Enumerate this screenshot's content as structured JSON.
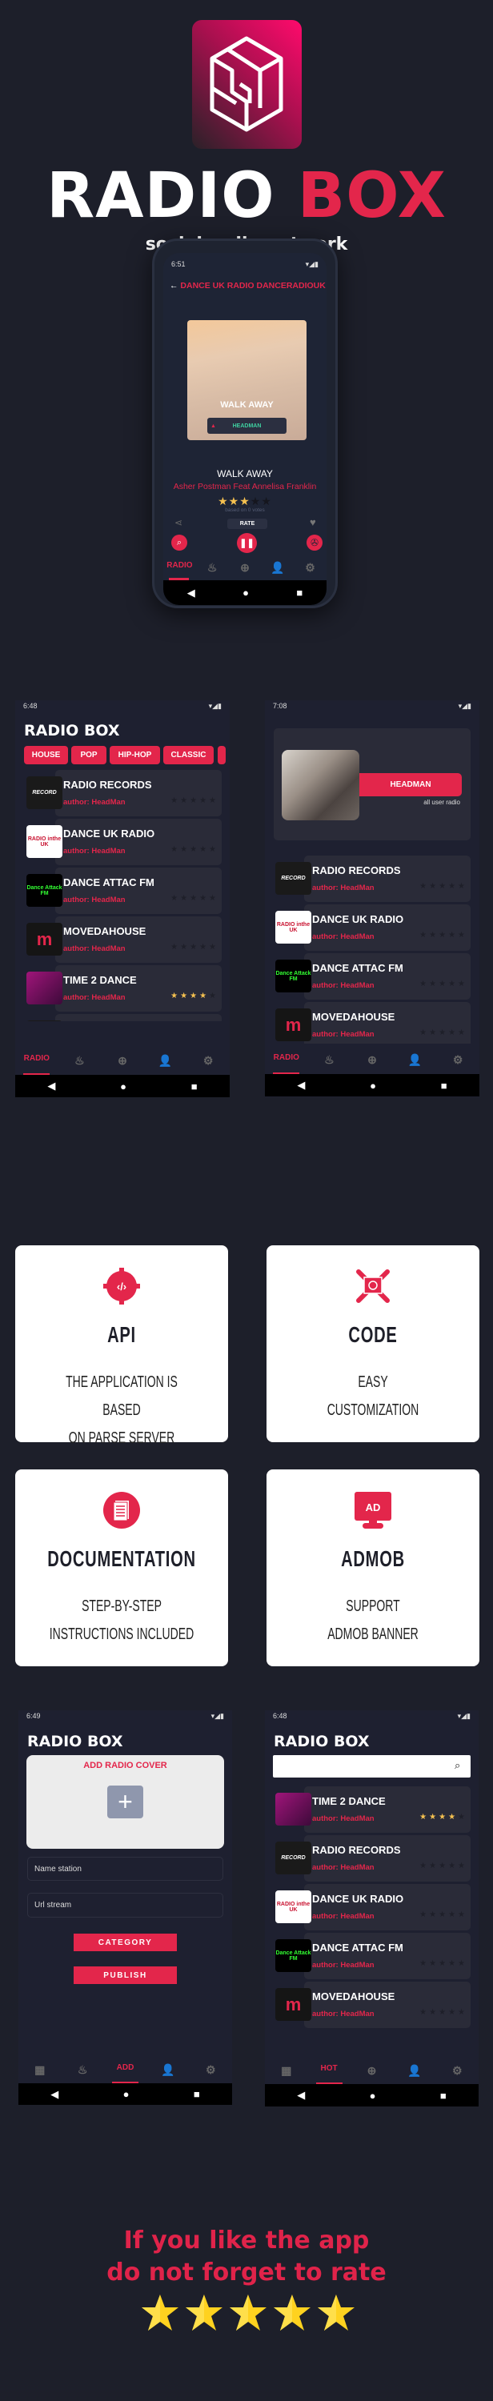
{
  "brand": {
    "title_a": "RADIO",
    "title_b": "BOX",
    "subtitle": "social radio network",
    "accent": "#e3264b"
  },
  "player": {
    "time": "6:51",
    "header": "DANCE UK RADIO DANCERADIOUK",
    "cover_text": "WALK AWAY",
    "cover_artist_chip": "HEADMAN",
    "track": "WALK AWAY",
    "artist": "Asher Postman Feat Annelisa Franklin",
    "rating": 3,
    "votes": "based on 0 votes",
    "rate_label": "RATE",
    "nav_active": "RADIO"
  },
  "nav_icons": [
    "radio",
    "flame-icon",
    "plus-circle-icon",
    "user-icon",
    "gear-icon"
  ],
  "thumbs": {
    "record": "RECORD",
    "uk": "RADIO inthe UK",
    "attac": "Dance Attack FM",
    "move": "m",
    "t2d": ""
  },
  "screen1": {
    "time": "6:48",
    "title": "RADIO BOX",
    "chips": [
      "HOUSE",
      "POP",
      "HIP-HOP",
      "CLASSIC"
    ],
    "nav_active": "RADIO",
    "stations": [
      {
        "name": "RADIO RECORDS",
        "author": "author: HeadMan",
        "rating": 0,
        "thumb": "record"
      },
      {
        "name": "DANCE UK RADIO",
        "author": "author: HeadMan",
        "rating": 0,
        "thumb": "uk"
      },
      {
        "name": "DANCE ATTAC FM",
        "author": "author: HeadMan",
        "rating": 0,
        "thumb": "attac"
      },
      {
        "name": "MOVEDAHOUSE",
        "author": "author: HeadMan",
        "rating": 0,
        "thumb": "move"
      },
      {
        "name": "TIME 2 DANCE",
        "author": "author: HeadMan",
        "rating": 4,
        "thumb": "t2d"
      },
      {
        "name": "",
        "author": "",
        "rating": 0,
        "thumb": "record"
      }
    ]
  },
  "screen2": {
    "time": "7:08",
    "user": "HEADMAN",
    "user_sub": "all user radio",
    "nav_active": "RADIO",
    "stations": [
      {
        "name": "RADIO RECORDS",
        "author": "author: HeadMan",
        "rating": 0,
        "thumb": "record"
      },
      {
        "name": "DANCE UK RADIO",
        "author": "author: HeadMan",
        "rating": 0,
        "thumb": "uk"
      },
      {
        "name": "DANCE ATTAC FM",
        "author": "author: HeadMan",
        "rating": 0,
        "thumb": "attac"
      },
      {
        "name": "MOVEDAHOUSE",
        "author": "author: HeadMan",
        "rating": 0,
        "thumb": "move"
      }
    ]
  },
  "features": [
    {
      "title": "API",
      "line1": "THE APPLICATION IS BASED",
      "line2": "ON PARSE SERVER",
      "icon": "code-gear-icon"
    },
    {
      "title": "CODE",
      "line1": "EASY",
      "line2": "CUSTOMIZATION",
      "icon": "tools-icon"
    },
    {
      "title": "DOCUMENTATION",
      "line1": "STEP-BY-STEP",
      "line2": "INSTRUCTIONS INCLUDED",
      "icon": "document-icon"
    },
    {
      "title": "ADMOB",
      "line1": "SUPPORT",
      "line2": "ADMOB BANNER",
      "icon": "ad-monitor-icon",
      "icon_text": "AD"
    }
  ],
  "screen3": {
    "time": "6:49",
    "title": "RADIO BOX",
    "cover_label": "ADD RADIO COVER",
    "name_placeholder": "Name station",
    "url_placeholder": "Url stream",
    "category": "CATEGORY",
    "publish": "PUBLISH",
    "nav_active": "ADD"
  },
  "screen4": {
    "time": "6:48",
    "title": "RADIO BOX",
    "search_value": "",
    "nav_active": "HOT",
    "stations": [
      {
        "name": "TIME 2 DANCE",
        "author": "author: HeadMan",
        "rating": 4,
        "thumb": "t2d"
      },
      {
        "name": "RADIO RECORDS",
        "author": "author: HeadMan",
        "rating": 0,
        "thumb": "record"
      },
      {
        "name": "DANCE UK RADIO",
        "author": "author: HeadMan",
        "rating": 0,
        "thumb": "uk"
      },
      {
        "name": "DANCE ATTAC FM",
        "author": "author: HeadMan",
        "rating": 0,
        "thumb": "attac"
      },
      {
        "name": "MOVEDAHOUSE",
        "author": "author: HeadMan",
        "rating": 0,
        "thumb": "move"
      },
      {
        "name": "",
        "author": "",
        "rating": 0,
        "thumb": "record"
      }
    ]
  },
  "footer": {
    "line1": "If you like the app",
    "line2": "do not forget to rate",
    "stars": 5
  }
}
